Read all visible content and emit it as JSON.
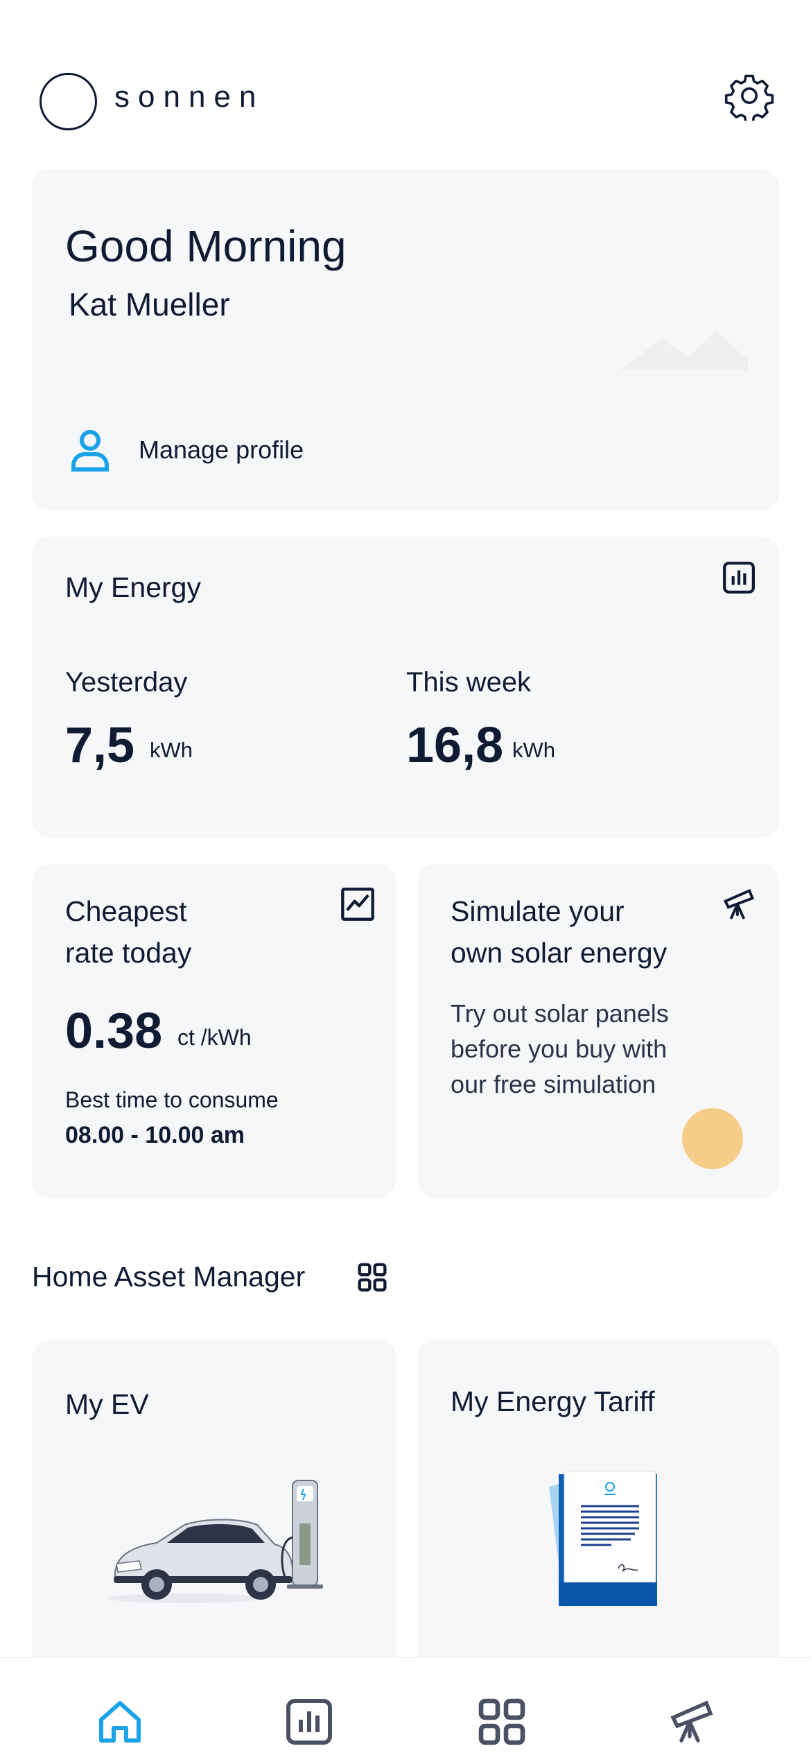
{
  "brand": {
    "name": "sonnen"
  },
  "greeting": {
    "title": "Good Morning",
    "name": "Kat Mueller",
    "manage_profile": "Manage profile"
  },
  "energy": {
    "title": "My Energy",
    "yesterday": {
      "label": "Yesterday",
      "value": "7,5",
      "unit": "kWh"
    },
    "this_week": {
      "label": "This week",
      "value": "16,8",
      "unit": "kWh"
    }
  },
  "rate": {
    "title_line1": "Cheapest",
    "title_line2": "rate today",
    "value": "0.38",
    "unit": "ct /kWh",
    "best_label": "Best time to consume",
    "best_time": "08.00 - 10.00 am"
  },
  "simulation": {
    "title_line1": "Simulate your",
    "title_line2": "own solar energy",
    "desc_line1": "Try out solar panels",
    "desc_line2": "before you buy with",
    "desc_line3": "our free simulation"
  },
  "asset_manager": {
    "title": "Home Asset Manager",
    "ev_title": "My EV",
    "tariff_title": "My Energy Tariff"
  },
  "colors": {
    "accent": "#1aa3e8",
    "ink": "#0f1a33",
    "card": "#f6f7f9",
    "sun": "#f5cc88",
    "nav_inactive": "#4b5064"
  },
  "nav": [
    "home-icon",
    "chart-icon",
    "grid-icon",
    "telescope-icon"
  ]
}
